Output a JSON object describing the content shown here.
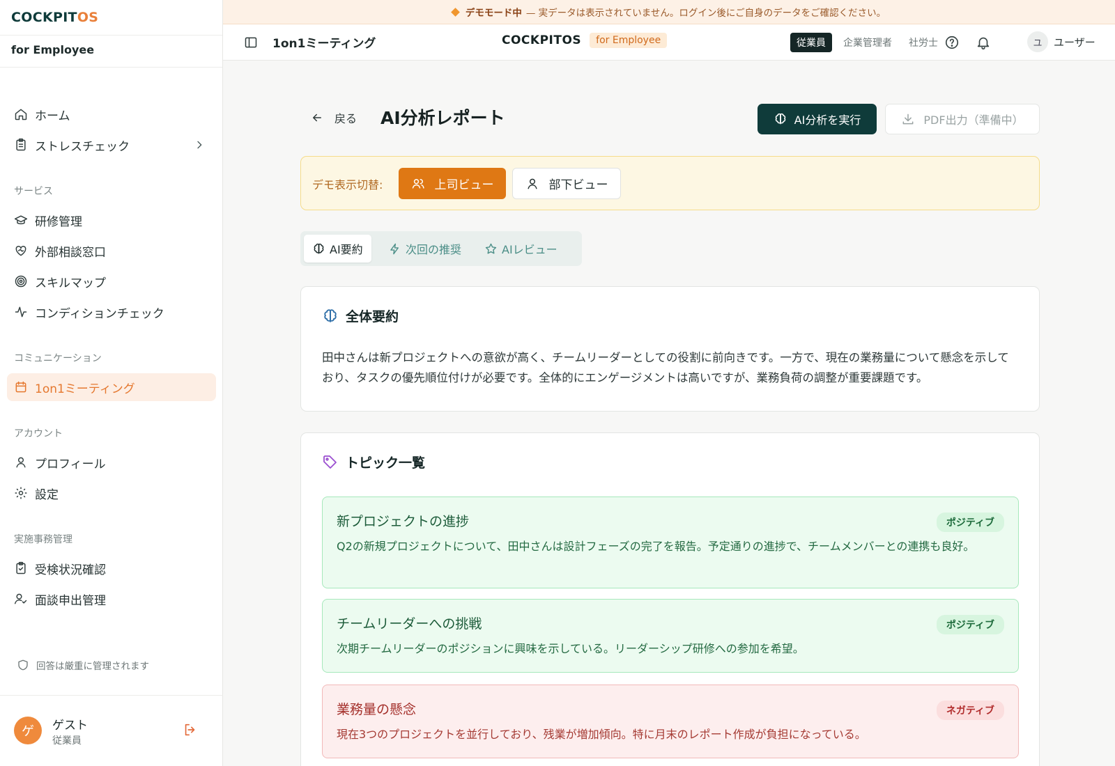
{
  "sidebar": {
    "brand_main": "COCKPIT",
    "brand_accent": "OS",
    "brand_sub": "for Employee",
    "items": {
      "home": "ホーム",
      "stress": "ストレスチェック",
      "training": "研修管理",
      "external": "外部相談窓口",
      "skillmap": "スキルマップ",
      "condition": "コンディションチェック",
      "oneonone": "1on1ミーティング",
      "profile": "プロフィール",
      "settings": "設定",
      "exam_status": "受検状況確認",
      "interview": "面談申出管理"
    },
    "sections": {
      "service": "サービス",
      "communication": "コミュニケーション",
      "account": "アカウント",
      "admin": "実施事務管理"
    },
    "privacy_note": "回答は厳重に管理されます",
    "user": {
      "initial": "ゲ",
      "name": "ゲスト",
      "role": "従業員"
    }
  },
  "banner": {
    "label": "デモモード中",
    "text": "— 実データは表示されていません。ログイン後にご自身のデータをご確認ください。"
  },
  "header": {
    "page_title": "1on1ミーティング",
    "brand": "COCKPITOS",
    "brand_badge": "for Employee",
    "roles": [
      "従業員",
      "企業管理者",
      "社労士"
    ],
    "user_initial": "ユ",
    "user_name": "ユーザー"
  },
  "main": {
    "back_label": "戻る",
    "title": "AI分析レポート",
    "run_button": "AI分析を実行",
    "pdf_button": "PDF出力（準備中）",
    "demo_toggle": {
      "label": "デモ表示切替:",
      "manager_view": "上司ビュー",
      "member_view": "部下ビュー"
    },
    "tabs": [
      "AI要約",
      "次回の推奨",
      "AIレビュー"
    ],
    "summary": {
      "heading": "全体要約",
      "text": "田中さんは新プロジェクトへの意欲が高く、チームリーダーとしての役割に前向きです。一方で、現在の業務量について懸念を示しており、タスクの優先順位付けが必要です。全体的にエンゲージメントは高いですが、業務負荷の調整が重要課題です。"
    },
    "topics": {
      "heading": "トピック一覧",
      "items": [
        {
          "title": "新プロジェクトの進捗",
          "badge": "ポジティブ",
          "body": "Q2の新規プロジェクトについて、田中さんは設計フェーズの完了を報告。予定通りの進捗で、チームメンバーとの連携も良好。"
        },
        {
          "title": "チームリーダーへの挑戦",
          "badge": "ポジティブ",
          "body": "次期チームリーダーのポジションに興味を示している。リーダーシップ研修への参加を希望。"
        },
        {
          "title": "業務量の懸念",
          "badge": "ネガティブ",
          "body": "現在3つのプロジェクトを並行しており、残業が増加傾向。特に月末のレポート作成が負担になっている。"
        }
      ]
    }
  },
  "colors": {
    "primary": "#0f3b3a",
    "accent": "#e9803a",
    "active_view": "#df7814",
    "positive": "#1d6b3b",
    "negative": "#b12d2d"
  }
}
